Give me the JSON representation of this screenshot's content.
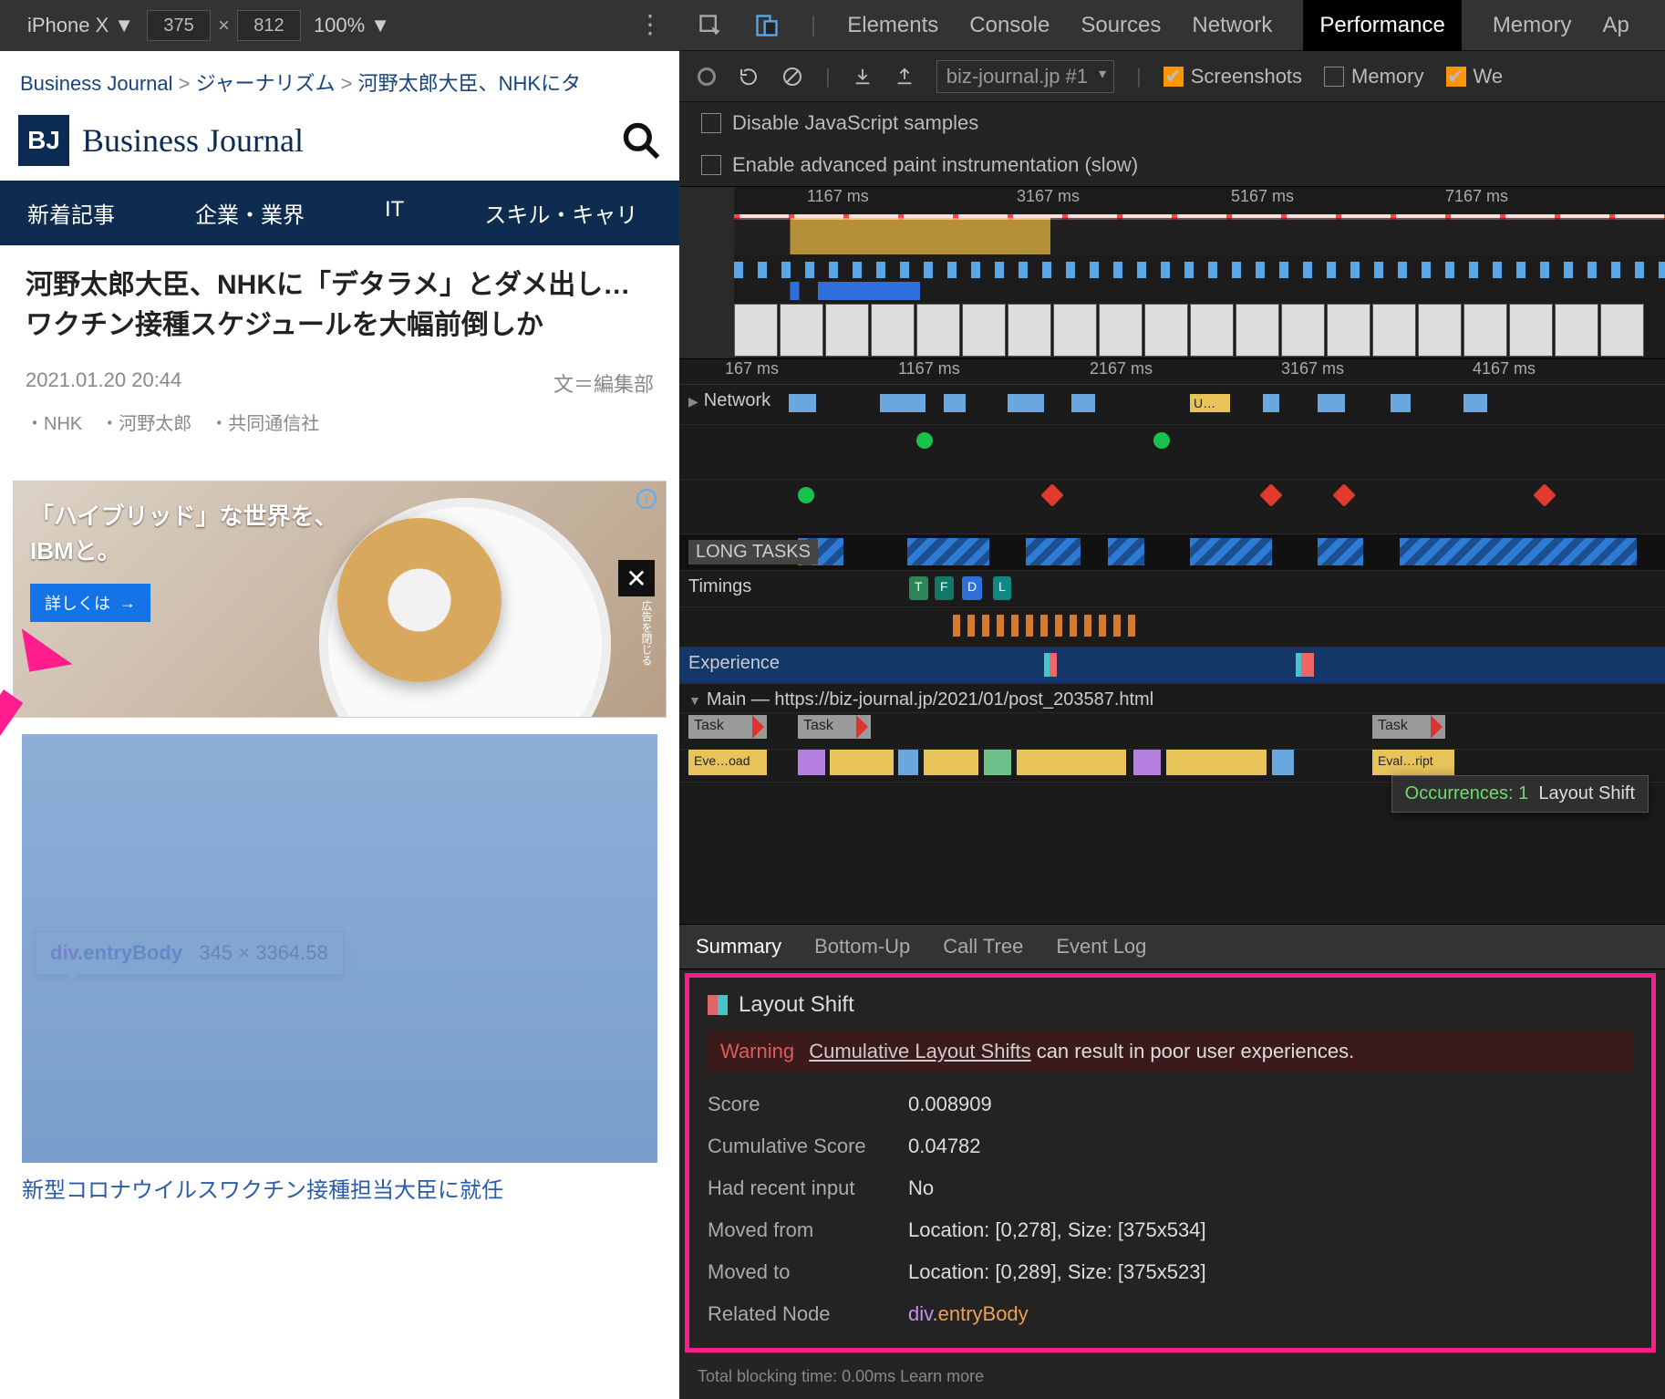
{
  "deviceToolbar": {
    "device": "iPhone X",
    "width": "375",
    "height": "812",
    "zoom": "100%"
  },
  "mobile": {
    "breadcrumbs": {
      "root": "Business Journal",
      "cat": "ジャーナリズム",
      "page": "河野太郎大臣、NHKにタ"
    },
    "brand": {
      "badge": "BJ",
      "name": "Business Journal"
    },
    "tabs": [
      "新着記事",
      "企業・業界",
      "IT",
      "スキル・キャリ"
    ],
    "article": {
      "title": "河野太郎大臣、NHKに「デタラメ」とダメ出し…ワクチン接種スケジュールを大幅前倒しか",
      "datetime": "2021.01.20 20:44",
      "byline": "文＝編集部",
      "tags": "・NHK　・河野太郎　・共同通信社"
    },
    "ad": {
      "line1": "「ハイブリッド」な世界を、",
      "line2": "IBMと。",
      "cta": "詳しくは",
      "ctaArrow": "→",
      "closeNote": "広告を閉じる"
    },
    "tooltip": {
      "el": "div",
      "cls": ".entryBody",
      "dims": "345 × 3364.58"
    },
    "caption": "新型コロナウイルスワクチン接種担当大臣に就任"
  },
  "devtools": {
    "panels": [
      "Elements",
      "Console",
      "Sources",
      "Network",
      "Performance",
      "Memory",
      "Ap"
    ],
    "activePanel": "Performance",
    "toolbar": {
      "url": "biz-journal.jp #1",
      "screenshots": "Screenshots",
      "memory": "Memory",
      "webvitals": "We"
    },
    "options": {
      "disableJs": "Disable JavaScript samples",
      "paint": "Enable advanced paint instrumentation (slow)"
    },
    "overviewTicks": [
      "1167 ms",
      "3167 ms",
      "5167 ms",
      "7167 ms"
    ],
    "flameTicks": [
      "167 ms",
      "1167 ms",
      "2167 ms",
      "3167 ms",
      "4167 ms"
    ],
    "rows": {
      "network": "Network",
      "longTasks": "LONG TASKS",
      "timings": "Timings",
      "experience": "Experience",
      "main": "Main — https://biz-journal.jp/2021/01/post_203587.html",
      "task": "Task",
      "eve": "Eve…oad",
      "evalr": "Eval…ript",
      "uchip": "U…",
      "tpill": "T",
      "fpill": "F",
      "dpill": "D",
      "lpill": "L"
    },
    "hoverTip": {
      "occ": "Occurrences: 1",
      "label": "Layout Shift"
    },
    "detailTabs": [
      "Summary",
      "Bottom-Up",
      "Call Tree",
      "Event Log"
    ],
    "activeDetailTab": "Summary",
    "detail": {
      "title": "Layout Shift",
      "warningLabel": "Warning",
      "warningLink": "Cumulative Layout Shifts",
      "warningRest": " can result in poor user experiences.",
      "score": {
        "k": "Score",
        "v": "0.008909"
      },
      "cscore": {
        "k": "Cumulative Score",
        "v": "0.04782"
      },
      "recent": {
        "k": "Had recent input",
        "v": "No"
      },
      "from": {
        "k": "Moved from",
        "v": "Location: [0,278], Size: [375x534]"
      },
      "to": {
        "k": "Moved to",
        "v": "Location: [0,289], Size: [375x523]"
      },
      "node": {
        "k": "Related Node",
        "el": "div",
        "cls": ".entryBody"
      }
    },
    "footerCut": "Total blocking time: 0.00ms  Learn more"
  }
}
